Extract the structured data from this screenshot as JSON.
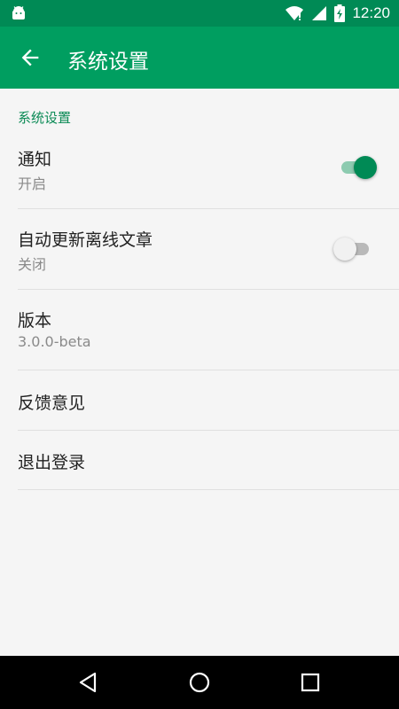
{
  "status_bar": {
    "time": "12:20",
    "icons": [
      "android-icon",
      "wifi-icon",
      "signal-icon",
      "battery-charging-icon"
    ]
  },
  "app_bar": {
    "title": "系统设置",
    "back_icon": "arrow-back-icon"
  },
  "settings": {
    "section_header": "系统设置",
    "notification": {
      "label": "通知",
      "summary": "开启",
      "enabled": true
    },
    "auto_update": {
      "label": "自动更新离线文章",
      "summary": "关闭",
      "enabled": false
    },
    "version": {
      "label": "版本",
      "summary": "3.0.0-beta"
    },
    "feedback": {
      "label": "反馈意见"
    },
    "logout": {
      "label": "退出登录"
    }
  },
  "colors": {
    "status_bar": "#008a55",
    "app_bar": "#009e60",
    "accent": "#008a55",
    "background": "#f5f5f5"
  },
  "nav_bar": {
    "icons": [
      "back-triangle-icon",
      "home-circle-icon",
      "recents-square-icon"
    ]
  }
}
